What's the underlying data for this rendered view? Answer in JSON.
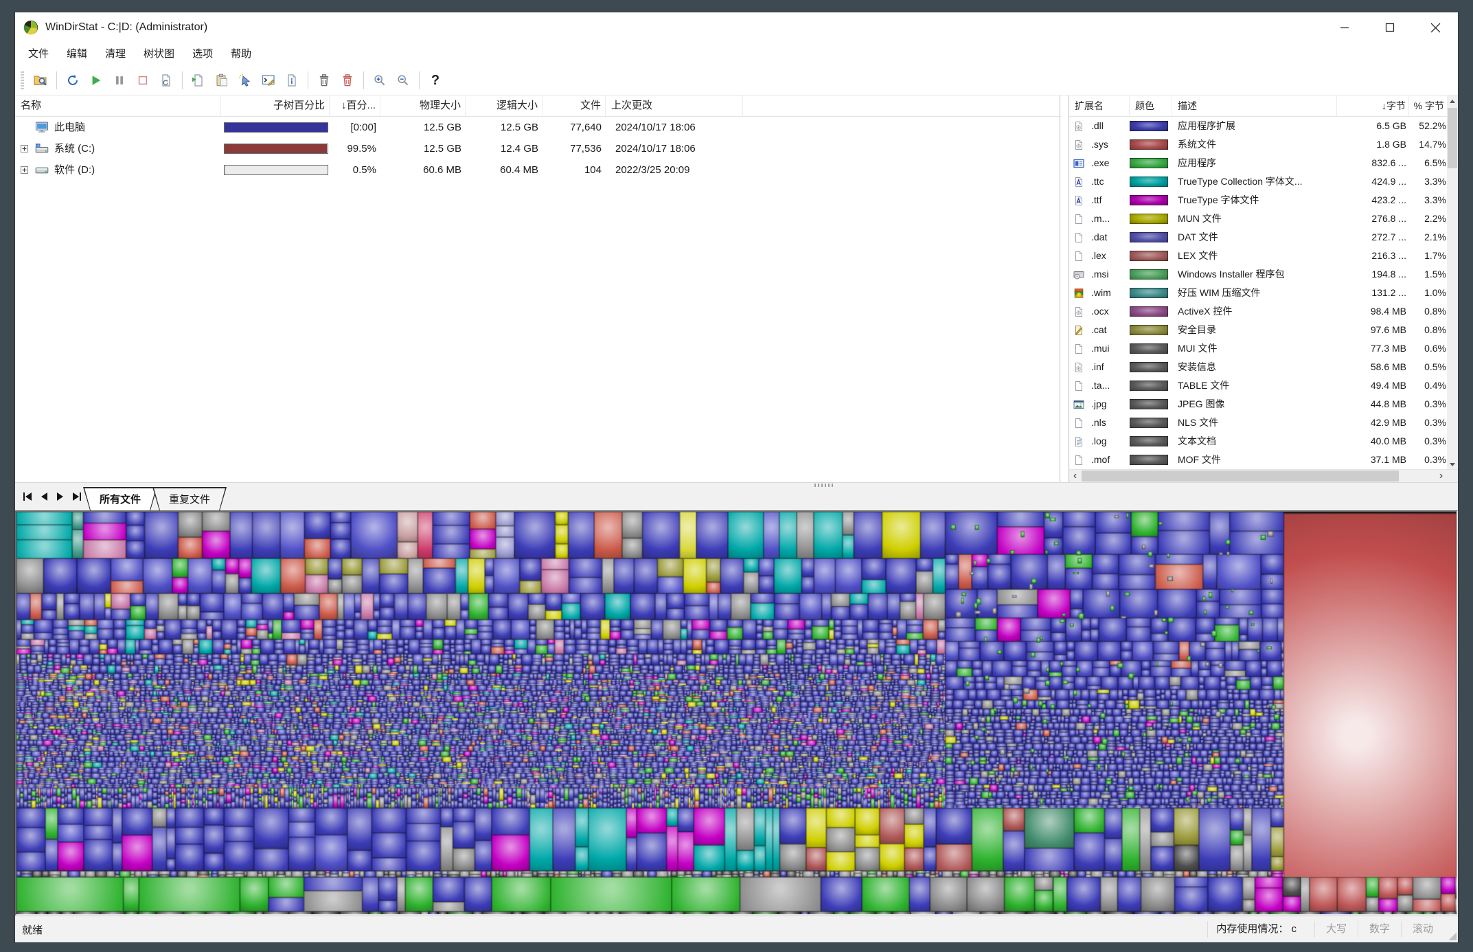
{
  "window": {
    "title": "WinDirStat - C:|D:  (Administrator)",
    "controls": {
      "minimize": "minimize",
      "maximize": "maximize",
      "close": "close"
    }
  },
  "menu": {
    "items": [
      "文件",
      "编辑",
      "清理",
      "树状图",
      "选项",
      "帮助"
    ]
  },
  "toolbar": {
    "buttons": [
      {
        "name": "open-report-button",
        "icon": "folder-search-icon"
      },
      {
        "sep": true
      },
      {
        "name": "refresh-all-button",
        "icon": "refresh-icon"
      },
      {
        "name": "resume-button",
        "icon": "play-icon"
      },
      {
        "name": "pause-button",
        "icon": "pause-icon"
      },
      {
        "name": "stop-button",
        "icon": "stop-icon"
      },
      {
        "name": "refresh-selected-button",
        "icon": "page-refresh-icon"
      },
      {
        "sep": true
      },
      {
        "name": "copy-path-button",
        "icon": "copy-icon"
      },
      {
        "name": "paste-button",
        "icon": "paste-icon"
      },
      {
        "name": "open-in-explorer-button",
        "icon": "cursor-select-icon"
      },
      {
        "name": "command-prompt-button",
        "icon": "console-icon"
      },
      {
        "name": "properties-button",
        "icon": "page-info-icon"
      },
      {
        "sep": true
      },
      {
        "name": "delete-to-recycle-button",
        "icon": "trash-icon"
      },
      {
        "name": "delete-permanently-button",
        "icon": "trash-red-icon"
      },
      {
        "sep": true
      },
      {
        "name": "zoom-in-button",
        "icon": "zoom-in-icon"
      },
      {
        "name": "zoom-out-button",
        "icon": "zoom-out-icon"
      },
      {
        "sep": true
      },
      {
        "name": "help-button",
        "icon": "help-icon"
      }
    ]
  },
  "tree": {
    "columns": [
      {
        "label": "名称",
        "align": "left"
      },
      {
        "label": "子树百分比",
        "align": "right"
      },
      {
        "label": "↓百分...",
        "align": "right"
      },
      {
        "label": "物理大小",
        "align": "right"
      },
      {
        "label": "逻辑大小",
        "align": "right"
      },
      {
        "label": "文件",
        "align": "right"
      },
      {
        "label": "上次更改",
        "align": "left"
      }
    ],
    "rows": [
      {
        "name": "此电脑",
        "icon": "computer-icon",
        "expand": false,
        "bar": {
          "color": "#34349a",
          "fill": 1
        },
        "pct": "[0:00]",
        "physical": "12.5 GB",
        "logical": "12.5 GB",
        "files": "77,640",
        "modified": "2024/10/17 18:06"
      },
      {
        "name": "系统 (C:)",
        "icon": "system-drive-icon",
        "expand": true,
        "bar": {
          "color": "#8b3a3a",
          "fill": 0.995
        },
        "pct": "99.5%",
        "physical": "12.5 GB",
        "logical": "12.4 GB",
        "files": "77,536",
        "modified": "2024/10/17 18:06"
      },
      {
        "name": "软件 (D:)",
        "icon": "drive-icon",
        "expand": true,
        "bar": {
          "color": "#c9c9c9",
          "fill": 0.005
        },
        "pct": "0.5%",
        "physical": "60.6 MB",
        "logical": "60.4 MB",
        "files": "104",
        "modified": "2022/3/25 20:09"
      }
    ]
  },
  "extensions": {
    "columns": [
      "扩展名",
      "颜色",
      "描述",
      "↓字节",
      "% 字节"
    ],
    "rows": [
      {
        "ext": ".dll",
        "icon": "gear-page-icon",
        "color": "#3c3caa",
        "desc": "应用程序扩展",
        "bytes": "6.5 GB",
        "pct": "52.2%"
      },
      {
        "ext": ".sys",
        "icon": "gear-page-icon",
        "color": "#a84a4a",
        "desc": "系统文件",
        "bytes": "1.8 GB",
        "pct": "14.7%"
      },
      {
        "ext": ".exe",
        "icon": "app-window-icon",
        "color": "#3aa844",
        "desc": "应用程序",
        "bytes": "832.6 ...",
        "pct": "6.5%"
      },
      {
        "ext": ".ttc",
        "icon": "font-file-icon",
        "color": "#00a0a0",
        "desc": "TrueType Collection 字体文...",
        "bytes": "424.9 ...",
        "pct": "3.3%"
      },
      {
        "ext": ".ttf",
        "icon": "font-file-icon",
        "color": "#aa00aa",
        "desc": "TrueType 字体文件",
        "bytes": "423.2 ...",
        "pct": "3.3%"
      },
      {
        "ext": ".m...",
        "icon": "page-icon",
        "color": "#a8a800",
        "desc": "MUN 文件",
        "bytes": "276.8 ...",
        "pct": "2.2%"
      },
      {
        "ext": ".dat",
        "icon": "page-icon",
        "color": "#5050a8",
        "desc": "DAT 文件",
        "bytes": "272.7 ...",
        "pct": "2.1%"
      },
      {
        "ext": ".lex",
        "icon": "page-icon",
        "color": "#a05c5c",
        "desc": "LEX 文件",
        "bytes": "216.3 ...",
        "pct": "1.7%"
      },
      {
        "ext": ".msi",
        "icon": "installer-icon",
        "color": "#4ca05c",
        "desc": "Windows Installer 程序包",
        "bytes": "194.8 ...",
        "pct": "1.5%"
      },
      {
        "ext": ".wim",
        "icon": "archive-icon",
        "color": "#3f8c8c",
        "desc": "好压 WIM 压缩文件",
        "bytes": "131.2 ...",
        "pct": "1.0%"
      },
      {
        "ext": ".ocx",
        "icon": "gear-page-icon",
        "color": "#8c4c88",
        "desc": "ActiveX 控件",
        "bytes": "98.4 MB",
        "pct": "0.8%"
      },
      {
        "ext": ".cat",
        "icon": "certificate-icon",
        "color": "#8c8c3f",
        "desc": "安全目录",
        "bytes": "97.6 MB",
        "pct": "0.8%"
      },
      {
        "ext": ".mui",
        "icon": "page-icon",
        "color": "#5a5a5a",
        "desc": "MUI 文件",
        "bytes": "77.3 MB",
        "pct": "0.6%"
      },
      {
        "ext": ".inf",
        "icon": "gear-page-icon",
        "color": "#5a5a5a",
        "desc": "安装信息",
        "bytes": "58.6 MB",
        "pct": "0.5%"
      },
      {
        "ext": ".ta...",
        "icon": "page-icon",
        "color": "#5a5a5a",
        "desc": "TABLE 文件",
        "bytes": "49.4 MB",
        "pct": "0.4%"
      },
      {
        "ext": ".jpg",
        "icon": "image-file-icon",
        "color": "#5a5a5a",
        "desc": "JPEG 图像",
        "bytes": "44.8 MB",
        "pct": "0.3%"
      },
      {
        "ext": ".nls",
        "icon": "page-icon",
        "color": "#5a5a5a",
        "desc": "NLS 文件",
        "bytes": "42.9 MB",
        "pct": "0.3%"
      },
      {
        "ext": ".log",
        "icon": "text-file-icon",
        "color": "#5a5a5a",
        "desc": "文本文档",
        "bytes": "40.0 MB",
        "pct": "0.3%"
      },
      {
        "ext": ".mof",
        "icon": "page-icon",
        "color": "#5a5a5a",
        "desc": "MOF 文件",
        "bytes": "37.1 MB",
        "pct": "0.3%"
      }
    ]
  },
  "tabs": {
    "items": [
      {
        "label": "所有文件",
        "active": true
      },
      {
        "label": "重复文件",
        "active": false
      }
    ]
  },
  "status": {
    "ready": "就绪",
    "memory": "内存使用情况：  c",
    "panes": [
      "大写",
      "数字",
      "滚动"
    ]
  },
  "treemap": {
    "dominant_color": "#3d3db8",
    "big_block_color": "#c24e4e",
    "accent_colors": [
      "#2fb32f",
      "#00a8a8",
      "#c400c4",
      "#cfcf00",
      "#cc5a4a",
      "#8f8f8f"
    ]
  }
}
